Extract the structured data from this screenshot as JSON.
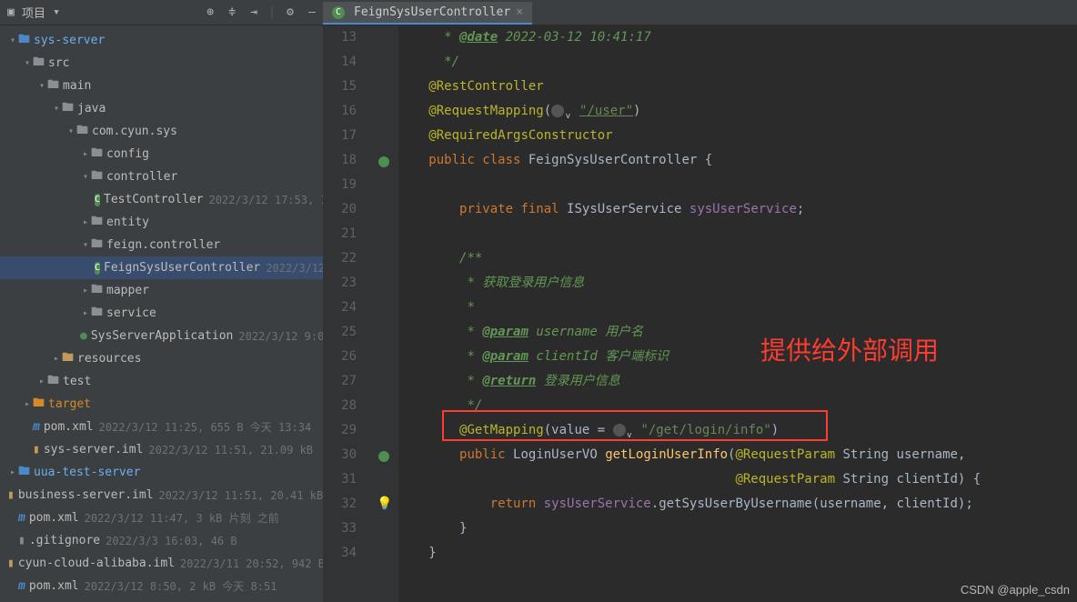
{
  "sidebar": {
    "title": "项目",
    "tree": [
      {
        "indent": 0,
        "chev": "v",
        "icon": "folder-blue",
        "label": "sys-server",
        "cls": "tree-label-blue"
      },
      {
        "indent": 1,
        "chev": "v",
        "icon": "folder",
        "label": "src"
      },
      {
        "indent": 2,
        "chev": "v",
        "icon": "folder",
        "label": "main"
      },
      {
        "indent": 3,
        "chev": "v",
        "icon": "folder",
        "label": "java"
      },
      {
        "indent": 4,
        "chev": "v",
        "icon": "folder",
        "label": "com.cyun.sys"
      },
      {
        "indent": 5,
        "chev": ">",
        "icon": "folder",
        "label": "config"
      },
      {
        "indent": 5,
        "chev": "v",
        "icon": "folder",
        "label": "controller"
      },
      {
        "indent": 6,
        "chev": "",
        "icon": "class",
        "label": "TestController",
        "meta": "2022/3/12 17:53, 1."
      },
      {
        "indent": 5,
        "chev": ">",
        "icon": "folder",
        "label": "entity"
      },
      {
        "indent": 5,
        "chev": "v",
        "icon": "folder",
        "label": "feign.controller"
      },
      {
        "indent": 6,
        "chev": "",
        "icon": "class",
        "label": "FeignSysUserController",
        "meta": "2022/3/12",
        "selected": true
      },
      {
        "indent": 5,
        "chev": ">",
        "icon": "folder",
        "label": "mapper"
      },
      {
        "indent": 5,
        "chev": ">",
        "icon": "folder",
        "label": "service"
      },
      {
        "indent": 5,
        "chev": "",
        "icon": "spring",
        "label": "SysServerApplication",
        "meta": "2022/3/12 9:0"
      },
      {
        "indent": 3,
        "chev": ">",
        "icon": "folder-res",
        "label": "resources"
      },
      {
        "indent": 2,
        "chev": ">",
        "icon": "folder",
        "label": "test"
      },
      {
        "indent": 1,
        "chev": ">",
        "icon": "folder-orange",
        "label": "target",
        "cls": "tree-label-orange"
      },
      {
        "indent": 1,
        "chev": "",
        "icon": "maven",
        "label": "pom.xml",
        "meta": "2022/3/12 11:25, 655 B 今天 13:34"
      },
      {
        "indent": 1,
        "chev": "",
        "icon": "file-brown",
        "label": "sys-server.iml",
        "meta": "2022/3/12 11:51, 21.09 kB"
      },
      {
        "indent": 0,
        "chev": ">",
        "icon": "folder-blue",
        "label": "uua-test-server",
        "cls": "tree-label-blue"
      },
      {
        "indent": 0,
        "chev": "",
        "icon": "file-brown",
        "label": "business-server.iml",
        "meta": "2022/3/12 11:51, 20.41 kB"
      },
      {
        "indent": 0,
        "chev": "",
        "icon": "maven",
        "label": "pom.xml",
        "meta": "2022/3/12 11:47, 3 kB 片刻 之前"
      },
      {
        "indent": 0,
        "chev": "",
        "icon": "file-gray",
        "label": ".gitignore",
        "meta": "2022/3/3 16:03, 46 B"
      },
      {
        "indent": 0,
        "chev": "",
        "icon": "file-brown",
        "label": "cyun-cloud-alibaba.iml",
        "meta": "2022/3/11 20:52, 942 B"
      },
      {
        "indent": 0,
        "chev": "",
        "icon": "maven",
        "label": "pom.xml",
        "meta": "2022/3/12 8:50, 2 kB 今天 8:51"
      }
    ]
  },
  "tab": {
    "label": "FeignSysUserController"
  },
  "lines": [
    13,
    14,
    15,
    16,
    17,
    18,
    19,
    20,
    21,
    22,
    23,
    24,
    25,
    26,
    27,
    28,
    29,
    30,
    31,
    32,
    33,
    34
  ],
  "code": {
    "l13": {
      "date_tag": "@date",
      "date_val": " 2022-03-12 10:41:17"
    },
    "l14": " */",
    "l15": "@RestController",
    "l16": {
      "anno": "@RequestMapping",
      "open": "(",
      "str": "\"/user\"",
      "close": ")"
    },
    "l17": "@RequiredArgsConstructor",
    "l18": {
      "kw": "public class ",
      "cls": "FeignSysUserController",
      "brace": " {"
    },
    "l20": {
      "kw1": "private final ",
      "type": "ISysUserService ",
      "field": "sysUserService",
      ";": ";"
    },
    "l22": "/**",
    "l23": " * 获取登录用户信息",
    "l24": " *",
    "l25": {
      "tag": "@param",
      "txt": " username 用户名"
    },
    "l26": {
      "tag": "@param",
      "txt": " clientId 客户端标识"
    },
    "l27": {
      "tag": "@return",
      "txt": " 登录用户信息"
    },
    "l28": " */",
    "l29": {
      "anno": "@GetMapping",
      "open": "(value = ",
      "str": "\"/get/login/info\"",
      "close": ")"
    },
    "l30": {
      "kw": "public ",
      "type": "LoginUserVO ",
      "method": "getLoginUserInfo",
      "p": "(",
      "anno": "@RequestParam ",
      "ptype": "String ",
      "pname": "username,"
    },
    "l31": {
      "anno": "@RequestParam ",
      "ptype": "String ",
      "pname": "clientId) {"
    },
    "l32": {
      "kw": "return ",
      "field": "sysUserService",
      "dot": ".",
      "method": "getSysUserByUsername",
      "args": "(username, clientId);"
    },
    "l33": "}",
    "l34": "}"
  },
  "annotation": {
    "text": "提供给外部调用"
  },
  "watermark": "CSDN @apple_csdn"
}
